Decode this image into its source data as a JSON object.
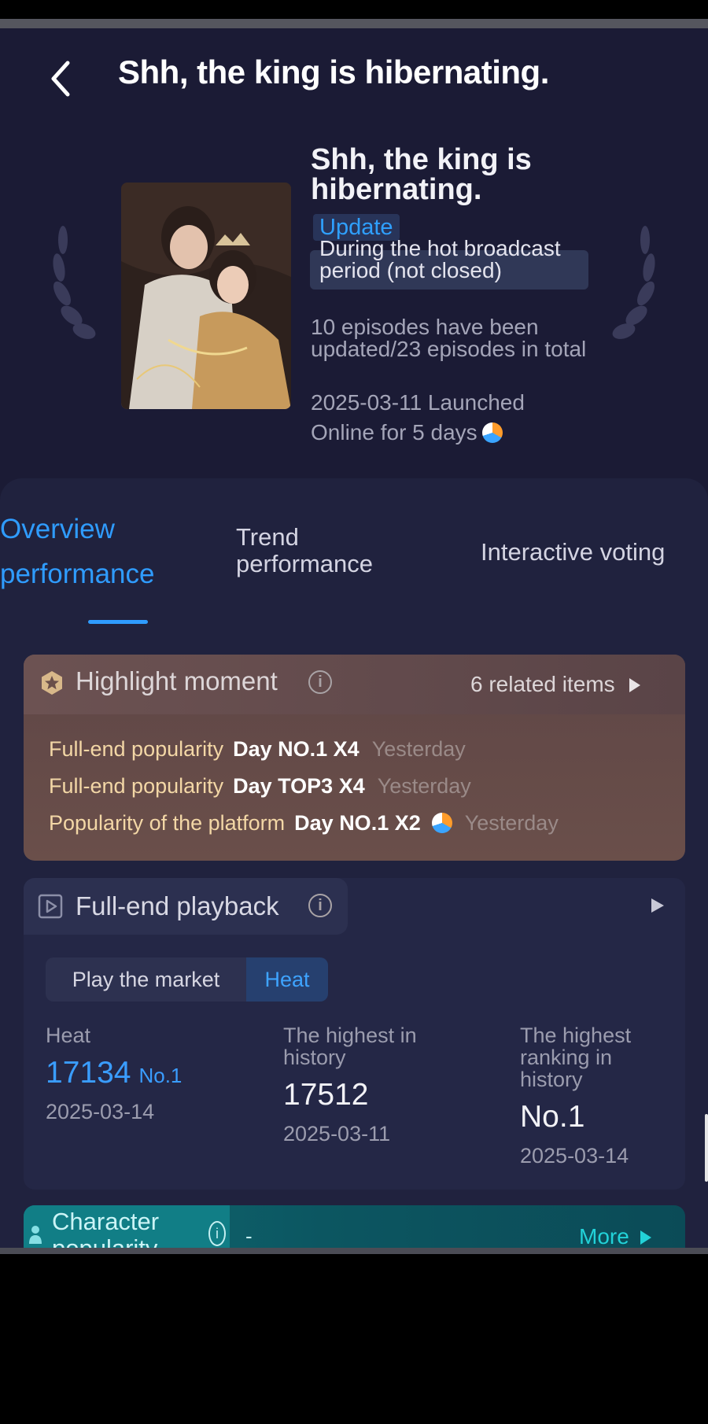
{
  "header": {
    "title": "Shh, the king is hibernating."
  },
  "drama": {
    "title": "Shh, the king is hibernating.",
    "update_badge": "Update",
    "status": "During the hot broadcast period (not closed)",
    "episodes": "10 episodes have been updated/23 episodes in total",
    "launched": "2025-03-11 Launched",
    "online": "Online for 5 days"
  },
  "tabs": [
    {
      "label": "Overview performance",
      "active": true
    },
    {
      "label": "Trend performance",
      "active": false
    },
    {
      "label": "Interactive voting",
      "active": false
    }
  ],
  "highlight": {
    "title": "Highlight moment",
    "related": "6 related items",
    "rows": [
      {
        "label": "Full-end popularity",
        "value": "Day NO.1 X4",
        "time": "Yesterday"
      },
      {
        "label": "Full-end popularity",
        "value": "Day TOP3 X4",
        "time": "Yesterday"
      },
      {
        "label": "Popularity of the platform",
        "value": "Day NO.1 X2",
        "time": "Yesterday"
      }
    ]
  },
  "playback": {
    "title": "Full-end playback",
    "segments": [
      "Play the market",
      "Heat"
    ],
    "active_segment": "Heat",
    "stats": {
      "heat_label": "Heat",
      "heat_value": "17134",
      "heat_rank": "No.1",
      "heat_date": "2025-03-14",
      "highest_label": "The highest in history",
      "highest_value": "17512",
      "highest_date": "2025-03-11",
      "ranking_label": "The highest ranking in history",
      "ranking_value": "No.1",
      "ranking_date": "2025-03-14"
    }
  },
  "character": {
    "title": "Character popularity",
    "dash": "-",
    "more": "More"
  },
  "colors": {
    "accent": "#2f9cff",
    "background": "#1b1b35",
    "highlight_card": "#5f4646",
    "character_bar": "#0f6b73"
  },
  "icons": [
    "back-arrow-icon",
    "star-badge-icon",
    "info-icon",
    "play-box-icon",
    "chevron-right-icon",
    "person-icon",
    "app-logo-icon",
    "laurel-icon"
  ]
}
